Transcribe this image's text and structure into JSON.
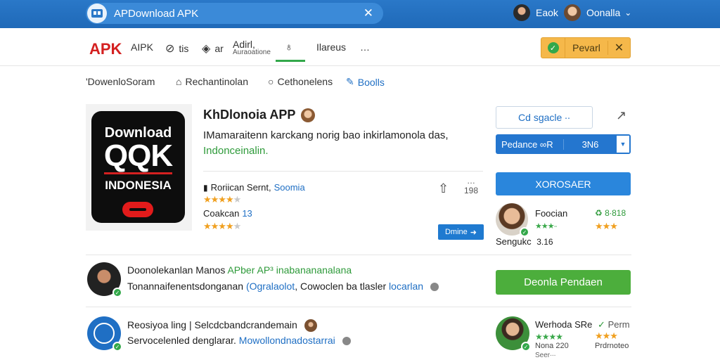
{
  "topbar": {
    "search_text": "APDownload APK",
    "close_glyph": "✕",
    "user1": "Eaok",
    "user2": "Oonalla",
    "user2_caret": "⌄"
  },
  "nav": {
    "logo": "APK",
    "items": [
      {
        "label": "AIPK"
      },
      {
        "label": "tis"
      },
      {
        "label": "ar"
      },
      {
        "label": "Adirl,",
        "sub": "Auraoatione"
      },
      {
        "label": ""
      },
      {
        "label": "Ilareus"
      },
      {
        "label": "…"
      }
    ],
    "action_label": "Pevarl",
    "action_close": "✕"
  },
  "subnav": {
    "items": [
      {
        "label": "'DowenloSoram"
      },
      {
        "label": "Rechantinolan"
      },
      {
        "label": "Cethonelens"
      },
      {
        "label": "Boolls"
      }
    ]
  },
  "cover": {
    "line1": "Download",
    "line2": "QQK",
    "line3": "INDONESIA"
  },
  "app": {
    "title": "KhDlonoia APP",
    "desc_main": "IMamaraitenn karckang norig bao inkirlamonola das,",
    "desc_green": "Indonceinalin.",
    "meta1_label": "Roriican Sernt,",
    "meta1_link": "Soomia",
    "stars1": "★★★★",
    "stars1_dim": "★",
    "meta2_label": "Coakcan",
    "meta2_value": "13",
    "stars2": "★★★★",
    "stars2_dim": "★",
    "share_top": "…",
    "share_count": "198",
    "small_button": "Dmine"
  },
  "right": {
    "outline_button": "Cd sgacle ∙∙",
    "select_label": "Pedance ∞R",
    "select_value": "3N6",
    "blue_button": "XOROSAER",
    "reviewer_name": "Foocian",
    "reviewer_rating": "♻ 8∙818",
    "reviewer_sub": "Sengukc",
    "reviewer_sub_value": "3.16",
    "stars_green": "★★★∙∙",
    "stars_orange": "★★★",
    "green_button": "Deonla Pendaen"
  },
  "rows": [
    {
      "title": "Doonolekanlan Manos",
      "title_green": "APber AP³ inabanananalana",
      "sub": "Tonannaifenentsdonganan",
      "sub_blue": "(Ogralaolot",
      "sub_after": ", Cowoclen ba tlasler",
      "sub_blue2": "locarlan"
    },
    {
      "title": "Reosiyoa ling",
      "title_after": "| Selcdcbandcrandemain",
      "sub": "Servocelenled denglarar.",
      "sub_blue": "Mowollondnadostarrai"
    }
  ],
  "bottom_right": {
    "name": "Werhoda SRe",
    "tag": "Perm",
    "stars_green": "★★★★",
    "stars_orange": "★★★",
    "count": "Nona 220",
    "count_right": "Prdrnoteo",
    "sub": "Seer∙∙∙"
  }
}
